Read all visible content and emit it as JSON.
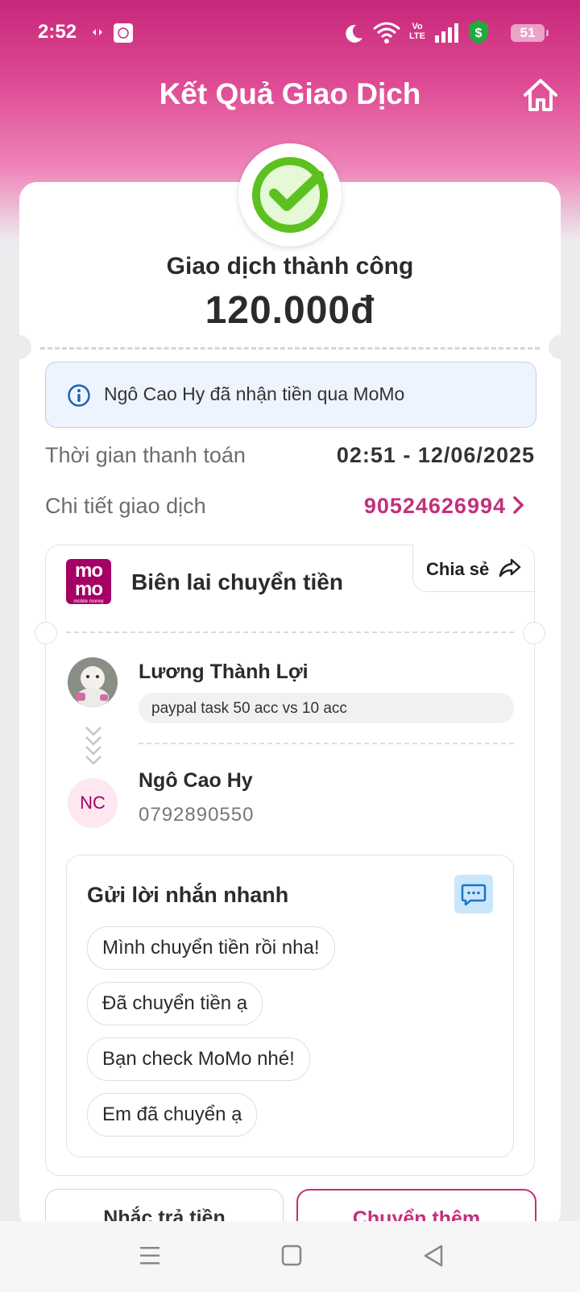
{
  "status_bar": {
    "time": "2:52",
    "battery": "51",
    "network": "Vo LTE"
  },
  "header": {
    "title": "Kết Quả Giao Dịch"
  },
  "result": {
    "status": "Giao dịch thành công",
    "amount": "120.000đ"
  },
  "info": {
    "message": "Ngô Cao Hy đã nhận tiền qua MoMo"
  },
  "details": {
    "time_label": "Thời gian thanh toán",
    "time_value": "02:51 - 12/06/2025",
    "tx_label": "Chi tiết giao dịch",
    "tx_value": "90524626994"
  },
  "receipt": {
    "logo_top": "mo",
    "logo_bottom": "mo",
    "logo_tagline": "mobile money",
    "title": "Biên lai chuyển tiền",
    "share_label": "Chia sẻ",
    "sender_name": "Lương Thành Lợi",
    "memo": "paypal task 50 acc vs 10 acc",
    "receiver_initials": "NC",
    "receiver_name": "Ngô Cao Hy",
    "receiver_phone": "0792890550"
  },
  "quick_message": {
    "title": "Gửi lời nhắn nhanh",
    "chips": [
      "Mình chuyển tiền rồi nha!",
      "Đã chuyển tiền ạ",
      "Bạn check MoMo nhé!",
      "Em đã chuyển ạ"
    ]
  },
  "actions": {
    "remind": "Nhắc trả tiền",
    "transfer_more": "Chuyển thêm"
  },
  "colors": {
    "brand": "#a50064",
    "accent": "#c2307c",
    "success": "#5cc11f"
  }
}
